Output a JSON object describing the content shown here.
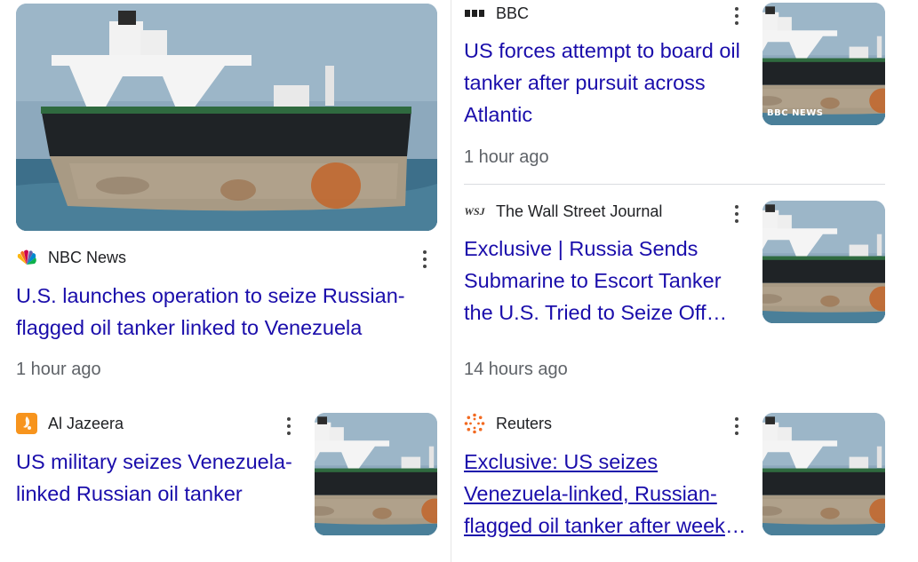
{
  "colors": {
    "headline_link": "#1a0dab",
    "meta_text": "#5f6368",
    "source_text": "#202124",
    "divider": "#dadce0"
  },
  "cards": [
    {
      "source": "NBC News",
      "logo": "nbc-peacock-icon",
      "headline": "U.S. launches operation to seize Russian-flagged oil tanker linked to Venezuela",
      "time": "1 hour ago"
    },
    {
      "source": "BBC",
      "logo": "bbc-blocks-icon",
      "headline": "US forces attempt to board oil tanker after pursuit across Atlantic",
      "time": "1 hour ago",
      "thumb_watermark": "BBC NEWS"
    },
    {
      "source": "The Wall Street Journal",
      "logo": "wsj-icon",
      "logo_text": "WSJ",
      "headline": "Exclusive | Russia Sends Submarine to Escort Tanker the U.S. Tried to Seize Off Venezuela",
      "time": "14 hours ago"
    },
    {
      "source": "Al Jazeera",
      "logo": "al-jazeera-icon",
      "headline": "US military seizes Venezuela-linked Russian oil tanker",
      "time": ""
    },
    {
      "source": "Reuters",
      "logo": "reuters-icon",
      "headline": "Exclusive: US seizes Venezuela-linked, Russian-flagged oil tanker after weeks-long pursuit",
      "time": ""
    }
  ]
}
